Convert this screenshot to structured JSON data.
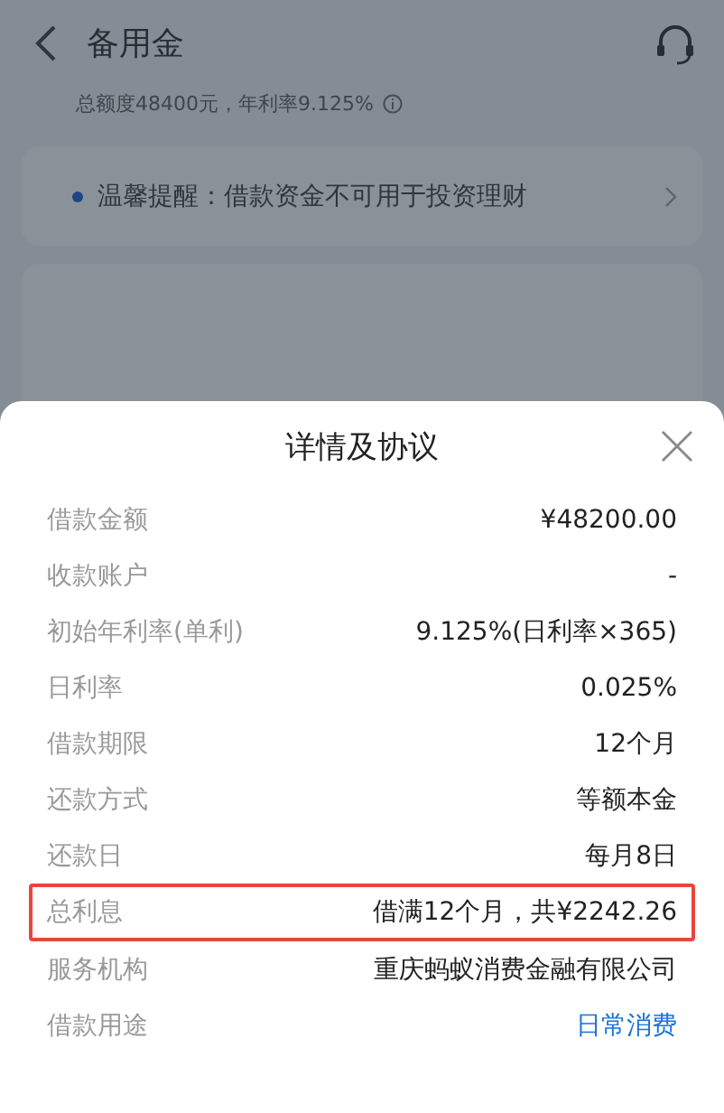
{
  "header": {
    "title": "备用金",
    "subtitle": "总额度48400元，年利率9.125%"
  },
  "notice": {
    "text": "温馨提醒：借款资金不可用于投资理财"
  },
  "sheet": {
    "title": "详情及协议",
    "rows": [
      {
        "label": "借款金额",
        "value": "¥48200.00",
        "kind": "text",
        "highlighted": false
      },
      {
        "label": "收款账户",
        "value": "-",
        "kind": "text",
        "highlighted": false
      },
      {
        "label": "初始年利率(单利)",
        "value": "9.125%(日利率×365)",
        "kind": "text",
        "highlighted": false
      },
      {
        "label": "日利率",
        "value": "0.025%",
        "kind": "text",
        "highlighted": false
      },
      {
        "label": "借款期限",
        "value": "12个月",
        "kind": "text",
        "highlighted": false
      },
      {
        "label": "还款方式",
        "value": "等额本金",
        "kind": "text",
        "highlighted": false
      },
      {
        "label": "还款日",
        "value": "每月8日",
        "kind": "text",
        "highlighted": false
      },
      {
        "label": "总利息",
        "value": "借满12个月，共¥2242.26",
        "kind": "text",
        "highlighted": true
      },
      {
        "label": "服务机构",
        "value": "重庆蚂蚁消费金融有限公司",
        "kind": "text",
        "highlighted": false
      },
      {
        "label": "借款用途",
        "value": "日常消费",
        "kind": "link",
        "highlighted": false
      }
    ]
  }
}
